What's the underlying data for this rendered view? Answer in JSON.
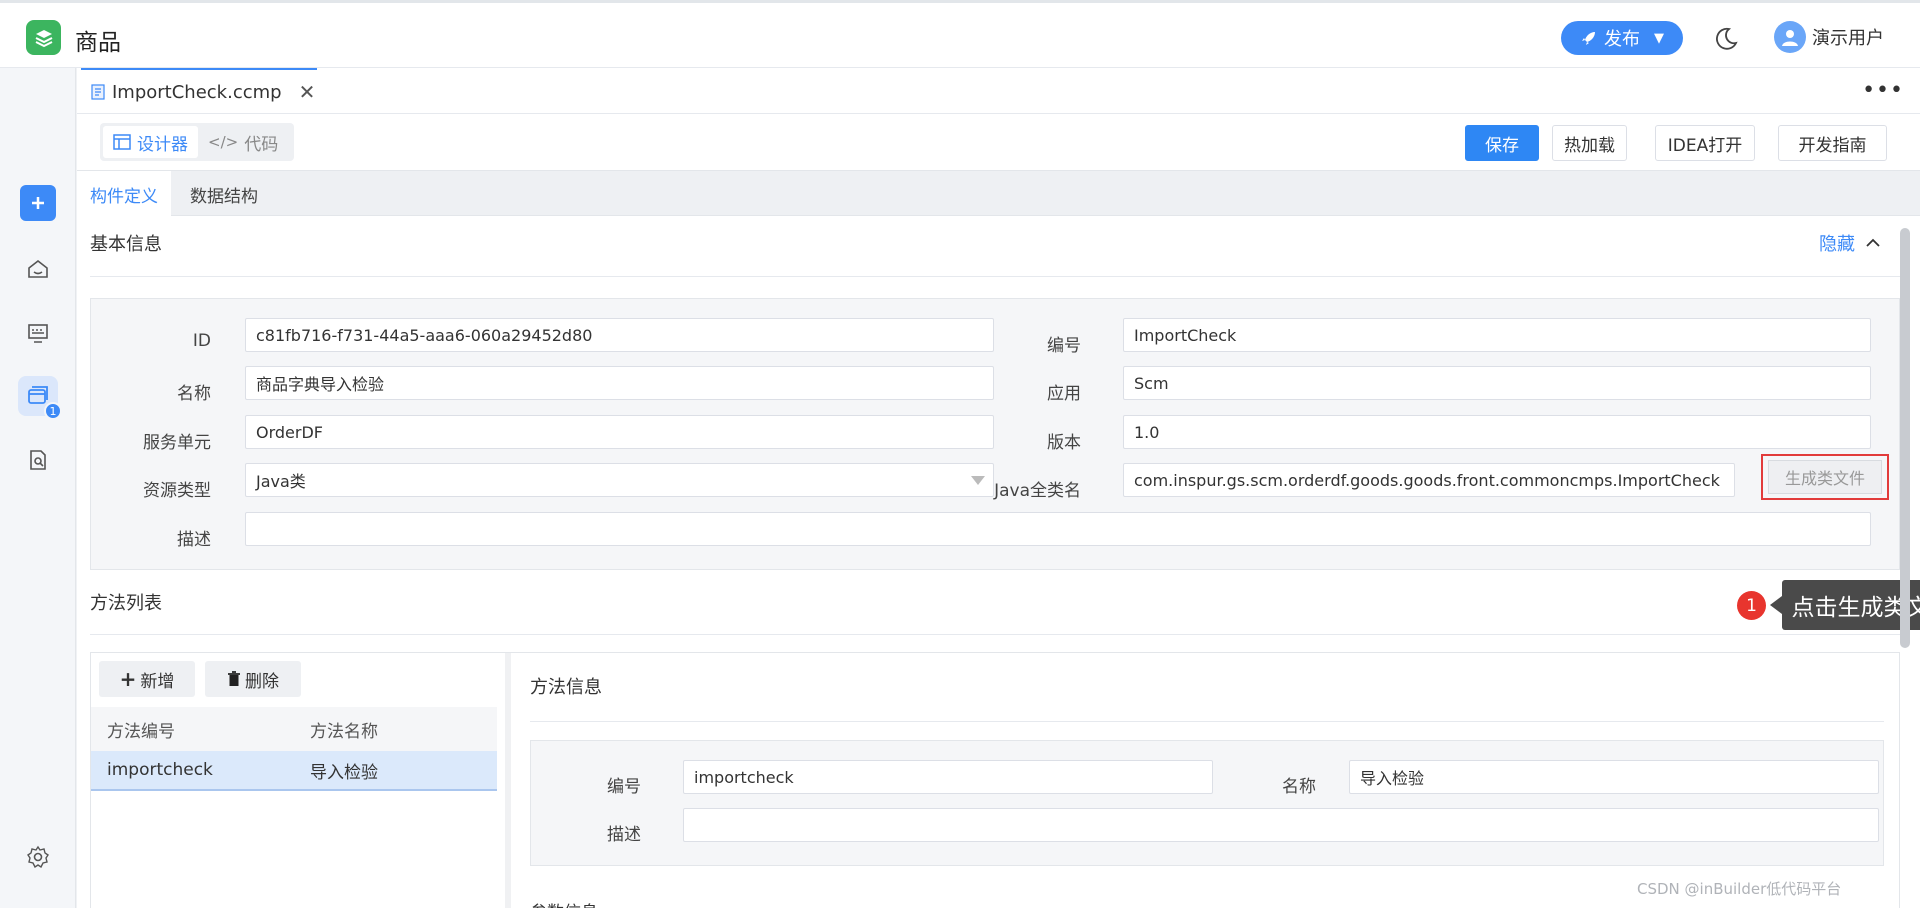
{
  "header": {
    "app_title": "商品",
    "publish_label": "发布",
    "user_name": "演示用户"
  },
  "file_tab": {
    "name": "ImportCheck.ccmp"
  },
  "toolbar": {
    "designer_label": "设计器",
    "code_label": "代码",
    "save_label": "保存",
    "hot_reload_label": "热加载",
    "idea_open_label": "IDEA打开",
    "dev_guide_label": "开发指南"
  },
  "subtabs": [
    "构件定义",
    "数据结构"
  ],
  "rail": {
    "badge": "1"
  },
  "basic_info": {
    "title": "基本信息",
    "collapse_label": "隐藏",
    "fields": {
      "id_label": "ID",
      "id_value": "c81fb716-f731-44a5-aaa6-060a29452d80",
      "code_label": "编号",
      "code_value": "ImportCheck",
      "name_label": "名称",
      "name_value": "商品字典导入检验",
      "app_label": "应用",
      "app_value": "Scm",
      "unit_label": "服务单元",
      "unit_value": "OrderDF",
      "version_label": "版本",
      "version_value": "1.0",
      "restype_label": "资源类型",
      "restype_value": "Java类",
      "classname_label": "Java全类名",
      "classname_value": "com.inspur.gs.scm.orderdf.goods.goods.front.commoncmps.ImportCheck",
      "desc_label": "描述",
      "desc_value": ""
    },
    "generate_button": "生成类文件"
  },
  "annotation": {
    "step": "1",
    "tooltip": "点击生成类文件"
  },
  "method_list": {
    "title": "方法列表",
    "add_label": "新增",
    "delete_label": "删除",
    "columns": [
      "方法编号",
      "方法名称"
    ],
    "rows": [
      {
        "code": "importcheck",
        "name": "导入检验"
      }
    ]
  },
  "method_info": {
    "title": "方法信息",
    "code_label": "编号",
    "code_value": "importcheck",
    "name_label": "名称",
    "name_value": "导入检验",
    "desc_label": "描述",
    "desc_value": "",
    "next_section_cut": "参数信息"
  },
  "watermark": "CSDN @inBuilder低代码平台"
}
